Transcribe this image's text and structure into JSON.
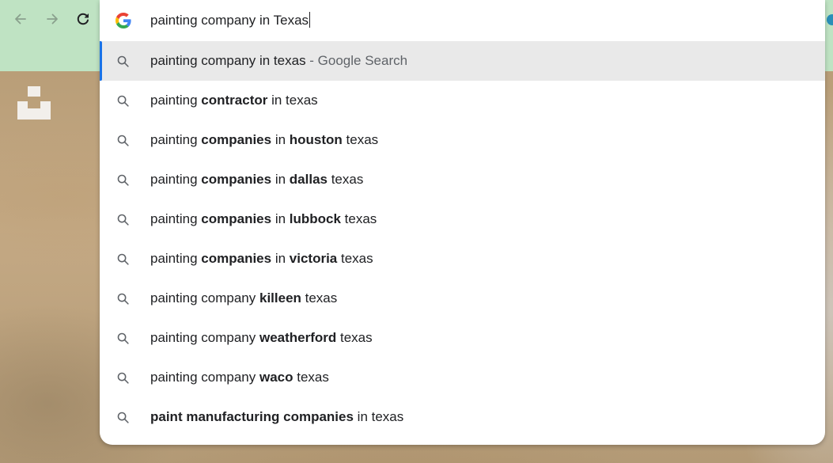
{
  "toolbar": {
    "back_icon": "arrow-left-icon",
    "forward_icon": "arrow-right-icon",
    "reload_icon": "reload-icon",
    "background_color": "#bfe3c3"
  },
  "site": {
    "logo_icon": "unsplash-logo"
  },
  "omnibox": {
    "input_value": "painting company in Texas",
    "provider_icon": "google-g-icon",
    "selected_accent": "#1a73e8",
    "suggestions": [
      {
        "segments": [
          {
            "text": "painting company in texas",
            "bold": false
          }
        ],
        "suffix": " - Google Search",
        "selected": true
      },
      {
        "segments": [
          {
            "text": "painting ",
            "bold": false
          },
          {
            "text": "contractor",
            "bold": true
          },
          {
            "text": " in texas",
            "bold": false
          }
        ]
      },
      {
        "segments": [
          {
            "text": "painting ",
            "bold": false
          },
          {
            "text": "companies",
            "bold": true
          },
          {
            "text": " in ",
            "bold": false
          },
          {
            "text": "houston",
            "bold": true
          },
          {
            "text": " texas",
            "bold": false
          }
        ]
      },
      {
        "segments": [
          {
            "text": "painting ",
            "bold": false
          },
          {
            "text": "companies",
            "bold": true
          },
          {
            "text": " in ",
            "bold": false
          },
          {
            "text": "dallas",
            "bold": true
          },
          {
            "text": " texas",
            "bold": false
          }
        ]
      },
      {
        "segments": [
          {
            "text": "painting ",
            "bold": false
          },
          {
            "text": "companies",
            "bold": true
          },
          {
            "text": " in ",
            "bold": false
          },
          {
            "text": "lubbock",
            "bold": true
          },
          {
            "text": " texas",
            "bold": false
          }
        ]
      },
      {
        "segments": [
          {
            "text": "painting ",
            "bold": false
          },
          {
            "text": "companies",
            "bold": true
          },
          {
            "text": " in ",
            "bold": false
          },
          {
            "text": "victoria",
            "bold": true
          },
          {
            "text": " texas",
            "bold": false
          }
        ]
      },
      {
        "segments": [
          {
            "text": "painting company ",
            "bold": false
          },
          {
            "text": "killeen",
            "bold": true
          },
          {
            "text": " texas",
            "bold": false
          }
        ]
      },
      {
        "segments": [
          {
            "text": "painting company ",
            "bold": false
          },
          {
            "text": "weatherford",
            "bold": true
          },
          {
            "text": " texas",
            "bold": false
          }
        ]
      },
      {
        "segments": [
          {
            "text": "painting company ",
            "bold": false
          },
          {
            "text": "waco",
            "bold": true
          },
          {
            "text": " texas",
            "bold": false
          }
        ]
      },
      {
        "segments": [
          {
            "text": "paint manufacturing companies",
            "bold": true
          },
          {
            "text": " in texas",
            "bold": false
          }
        ]
      }
    ]
  }
}
